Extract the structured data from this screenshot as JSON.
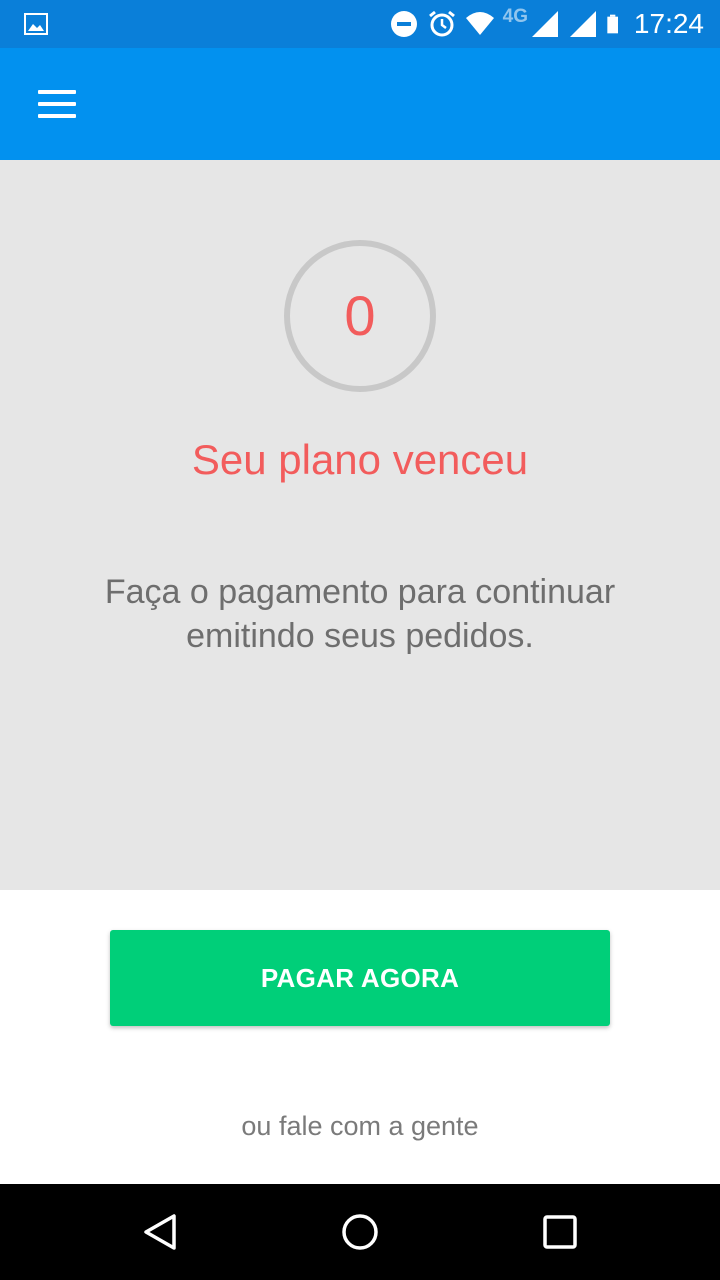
{
  "status_bar": {
    "time": "17:24",
    "network_type": "4G",
    "icons": [
      "image-notification-icon",
      "do-not-disturb-icon",
      "alarm-icon",
      "wifi-icon",
      "cell-signal-icon",
      "cell-signal-icon",
      "battery-icon"
    ]
  },
  "app_bar": {
    "menu_icon": "hamburger-menu-icon",
    "color": "#0291ef"
  },
  "plan_status": {
    "days_remaining": "0",
    "title": "Seu plano venceu",
    "message": "Faça o pagamento para continuar emitindo seus pedidos."
  },
  "actions": {
    "pay_button_label": "PAGAR AGORA",
    "contact_link": "ou fale com a gente"
  },
  "colors": {
    "accent_blue": "#0291ef",
    "status_bar_blue": "#0a7fd9",
    "alert_red": "#f25c5c",
    "pay_green": "#00cf79",
    "content_grey": "#e6e6e6"
  },
  "nav_bar": {
    "buttons": [
      "back-icon",
      "home-icon",
      "recents-icon"
    ]
  }
}
